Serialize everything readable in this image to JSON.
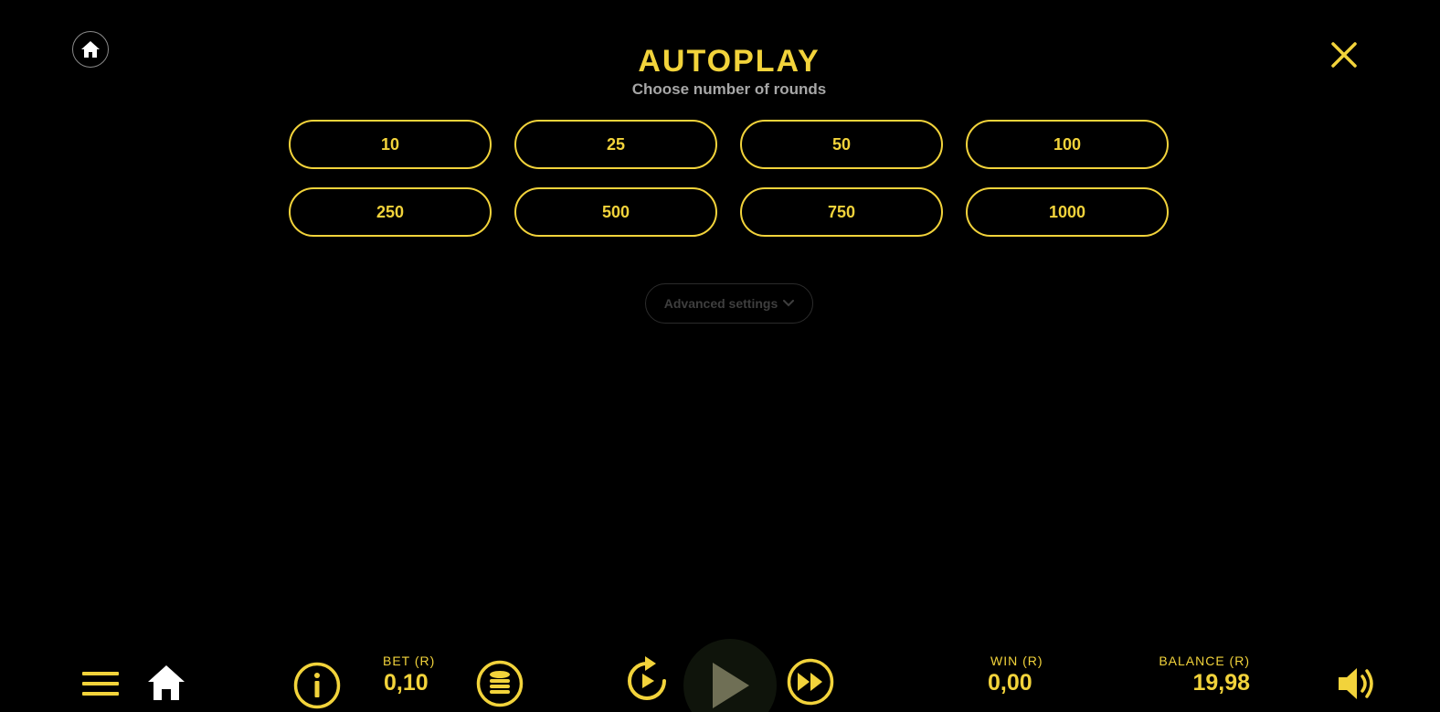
{
  "header": {
    "title": "AUTOPLAY",
    "subtitle": "Choose number of rounds"
  },
  "rounds": [
    "10",
    "25",
    "50",
    "100",
    "250",
    "500",
    "750",
    "1000"
  ],
  "advanced": {
    "label": "Advanced settings"
  },
  "bottom_bar": {
    "bet_label": "BET (R)",
    "bet_value": "0,10",
    "win_label": "WIN (R)",
    "win_value": "0,00",
    "balance_label": "BALANCE (R)",
    "balance_value": "19,98"
  },
  "icons": {
    "home_top": "home-icon",
    "close": "close-icon",
    "menu": "menu-icon",
    "home_bottom": "home-icon",
    "info": "info-icon",
    "coins": "coins-icon",
    "replay": "replay-icon",
    "play": "play-icon",
    "turbo": "fast-forward-icon",
    "sound": "speaker-icon"
  },
  "colors": {
    "accent": "#f2d33b",
    "background": "#000000",
    "subtitle": "#a7a7a7",
    "disabled": "#3e3e3e"
  }
}
